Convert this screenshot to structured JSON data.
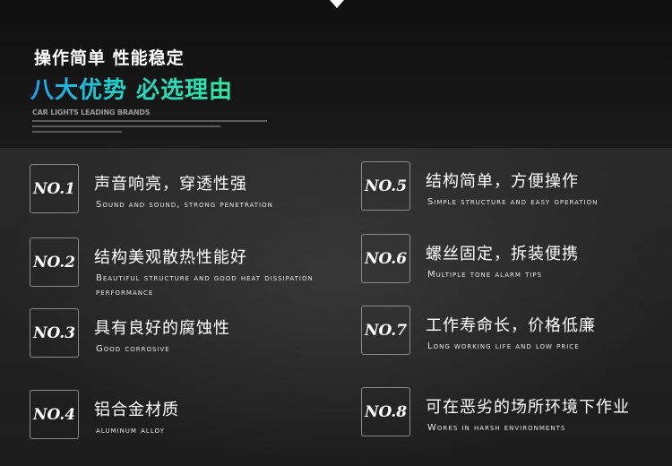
{
  "header": {
    "headline": "操作简单 性能稳定",
    "title": "八大优势 必选理由",
    "brand": "CAR LIGHTS LEADING BRANDS"
  },
  "items": [
    {
      "badge": "NO.1",
      "cn": "声音响亮，穿透性强",
      "en": "Sound and sound, strong penetration"
    },
    {
      "badge": "NO.2",
      "cn": "结构美观散热性能好",
      "en": "Beautiful structure and good heat dissipation performance"
    },
    {
      "badge": "NO.3",
      "cn": "具有良好的腐蚀性",
      "en": "Good corrosive"
    },
    {
      "badge": "NO.4",
      "cn": "铝合金材质",
      "en": "aluminum alloy"
    },
    {
      "badge": "NO.5",
      "cn": "结构简单，方便操作",
      "en": "Simple structure and easy operation"
    },
    {
      "badge": "NO.6",
      "cn": "螺丝固定，拆装便携",
      "en": "Multiple tone alarm tips"
    },
    {
      "badge": "NO.7",
      "cn": "工作寿命长，价格低廉",
      "en": "Long working life and low price"
    },
    {
      "badge": "NO.8",
      "cn": "可在恶劣的场所环境下作业",
      "en": "Works in harsh environments"
    }
  ]
}
